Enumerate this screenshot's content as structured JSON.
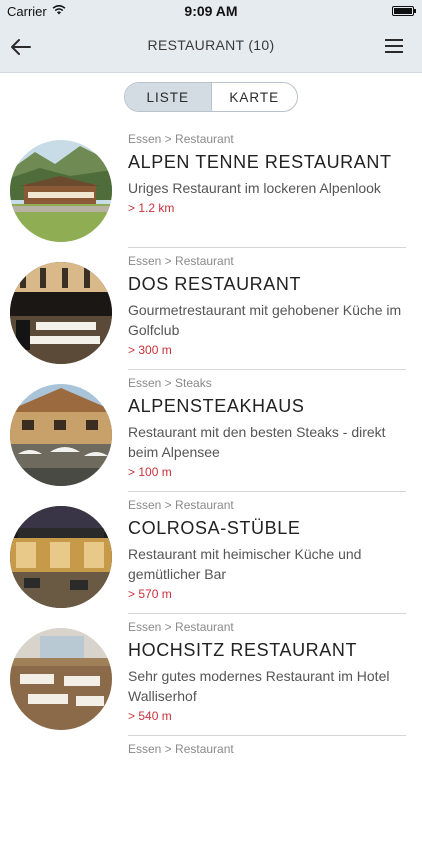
{
  "status_bar": {
    "carrier": "Carrier",
    "time": "9:09 AM"
  },
  "nav": {
    "title": "RESTAURANT (10)",
    "back_icon": "back-arrow-icon",
    "menu_icon": "hamburger-menu-icon"
  },
  "segmented": {
    "list_label": "LISTE",
    "map_label": "KARTE",
    "selected": "LISTE"
  },
  "colors": {
    "header_bg": "#e6ebf0",
    "segment_active": "#d3dbe3",
    "distance": "#c8323a"
  },
  "items": [
    {
      "category": "Essen > Restaurant",
      "title": "ALPEN TENNE RESTAURANT",
      "description": "Uriges Restaurant im lockeren Alpenlook",
      "distance": "> 1.2 km"
    },
    {
      "category": "Essen > Restaurant",
      "title": "DOS RESTAURANT",
      "description": "Gourmetrestaurant mit gehobener Küche im Golfclub",
      "distance": "> 300 m"
    },
    {
      "category": "Essen > Steaks",
      "title": "ALPENSTEAKHAUS",
      "description": "Restaurant mit den besten Steaks - direkt beim Alpensee",
      "distance": "> 100 m"
    },
    {
      "category": "Essen > Restaurant",
      "title": "COLROSA-STÜBLE",
      "description": "Restaurant mit heimischer Küche und gemütlicher Bar",
      "distance": "> 570 m"
    },
    {
      "category": "Essen > Restaurant",
      "title": "HOCHSITZ RESTAURANT",
      "description": "Sehr gutes modernes Restaurant im Hotel Walliserhof",
      "distance": "> 540 m"
    },
    {
      "category": "Essen > Restaurant"
    }
  ]
}
